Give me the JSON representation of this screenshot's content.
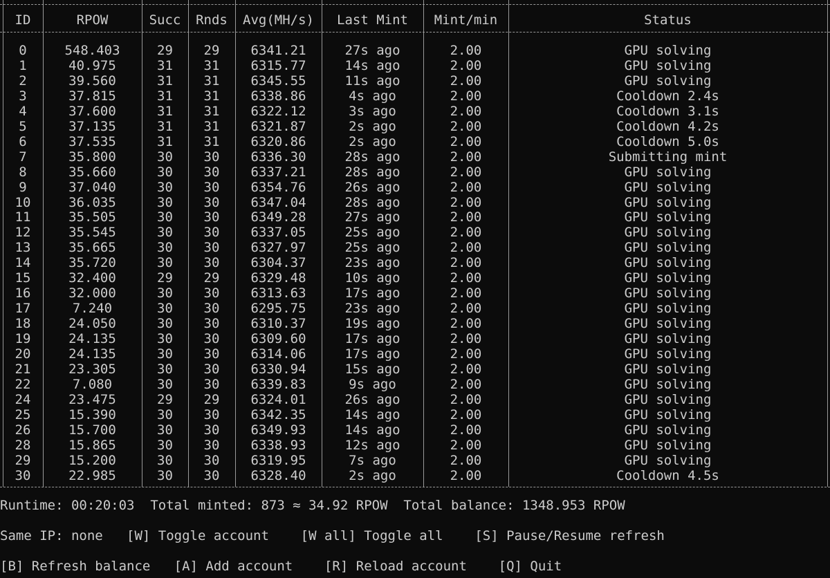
{
  "headers": [
    "ID",
    "RPOW",
    "Succ",
    "Rnds",
    "Avg(MH/s)",
    "Last Mint",
    "Mint/min",
    "Status"
  ],
  "rows": [
    [
      "0",
      "548.403",
      "29",
      "29",
      "6341.21",
      "27s ago",
      "2.00",
      "GPU solving"
    ],
    [
      "1",
      "40.975",
      "31",
      "31",
      "6315.77",
      "14s ago",
      "2.00",
      "GPU solving"
    ],
    [
      "2",
      "39.560",
      "31",
      "31",
      "6345.55",
      "11s ago",
      "2.00",
      "GPU solving"
    ],
    [
      "3",
      "37.815",
      "31",
      "31",
      "6338.86",
      "4s ago",
      "2.00",
      "Cooldown 2.4s"
    ],
    [
      "4",
      "37.600",
      "31",
      "31",
      "6322.12",
      "3s ago",
      "2.00",
      "Cooldown 3.1s"
    ],
    [
      "5",
      "37.135",
      "31",
      "31",
      "6321.87",
      "2s ago",
      "2.00",
      "Cooldown 4.2s"
    ],
    [
      "6",
      "37.535",
      "31",
      "31",
      "6320.86",
      "2s ago",
      "2.00",
      "Cooldown 5.0s"
    ],
    [
      "7",
      "35.800",
      "30",
      "30",
      "6336.30",
      "28s ago",
      "2.00",
      "Submitting mint"
    ],
    [
      "8",
      "35.660",
      "30",
      "30",
      "6337.21",
      "28s ago",
      "2.00",
      "GPU solving"
    ],
    [
      "9",
      "37.040",
      "30",
      "30",
      "6354.76",
      "26s ago",
      "2.00",
      "GPU solving"
    ],
    [
      "10",
      "36.035",
      "30",
      "30",
      "6347.04",
      "28s ago",
      "2.00",
      "GPU solving"
    ],
    [
      "11",
      "35.505",
      "30",
      "30",
      "6349.28",
      "27s ago",
      "2.00",
      "GPU solving"
    ],
    [
      "12",
      "35.545",
      "30",
      "30",
      "6337.05",
      "25s ago",
      "2.00",
      "GPU solving"
    ],
    [
      "13",
      "35.665",
      "30",
      "30",
      "6327.97",
      "25s ago",
      "2.00",
      "GPU solving"
    ],
    [
      "14",
      "35.720",
      "30",
      "30",
      "6304.37",
      "23s ago",
      "2.00",
      "GPU solving"
    ],
    [
      "15",
      "32.400",
      "29",
      "29",
      "6329.48",
      "10s ago",
      "2.00",
      "GPU solving"
    ],
    [
      "16",
      "32.000",
      "30",
      "30",
      "6313.63",
      "17s ago",
      "2.00",
      "GPU solving"
    ],
    [
      "17",
      "7.240",
      "30",
      "30",
      "6295.75",
      "23s ago",
      "2.00",
      "GPU solving"
    ],
    [
      "18",
      "24.050",
      "30",
      "30",
      "6310.37",
      "19s ago",
      "2.00",
      "GPU solving"
    ],
    [
      "19",
      "24.135",
      "30",
      "30",
      "6309.60",
      "17s ago",
      "2.00",
      "GPU solving"
    ],
    [
      "20",
      "24.135",
      "30",
      "30",
      "6314.06",
      "17s ago",
      "2.00",
      "GPU solving"
    ],
    [
      "21",
      "23.305",
      "30",
      "30",
      "6330.94",
      "15s ago",
      "2.00",
      "GPU solving"
    ],
    [
      "22",
      "7.080",
      "30",
      "30",
      "6339.83",
      "9s ago",
      "2.00",
      "GPU solving"
    ],
    [
      "24",
      "23.475",
      "29",
      "29",
      "6324.01",
      "26s ago",
      "2.00",
      "GPU solving"
    ],
    [
      "25",
      "15.390",
      "30",
      "30",
      "6342.35",
      "14s ago",
      "2.00",
      "GPU solving"
    ],
    [
      "26",
      "15.700",
      "30",
      "30",
      "6349.93",
      "14s ago",
      "2.00",
      "GPU solving"
    ],
    [
      "28",
      "15.865",
      "30",
      "30",
      "6338.93",
      "12s ago",
      "2.00",
      "GPU solving"
    ],
    [
      "29",
      "15.200",
      "30",
      "30",
      "6319.95",
      "7s ago",
      "2.00",
      "GPU solving"
    ],
    [
      "30",
      "22.985",
      "30",
      "30",
      "6328.40",
      "2s ago",
      "2.00",
      "Cooldown 4.5s"
    ]
  ],
  "footer": {
    "runtime": "Runtime: 00:20:03  Total minted: 873 ≈ 34.92 RPOW  Total balance: 1348.953 RPOW",
    "line2": "Same IP: none   [W] Toggle account    [W all] Toggle all    [S] Pause/Resume refresh",
    "line3": "[B] Refresh balance   [A] Add account    [R] Reload account    [Q] Quit"
  }
}
